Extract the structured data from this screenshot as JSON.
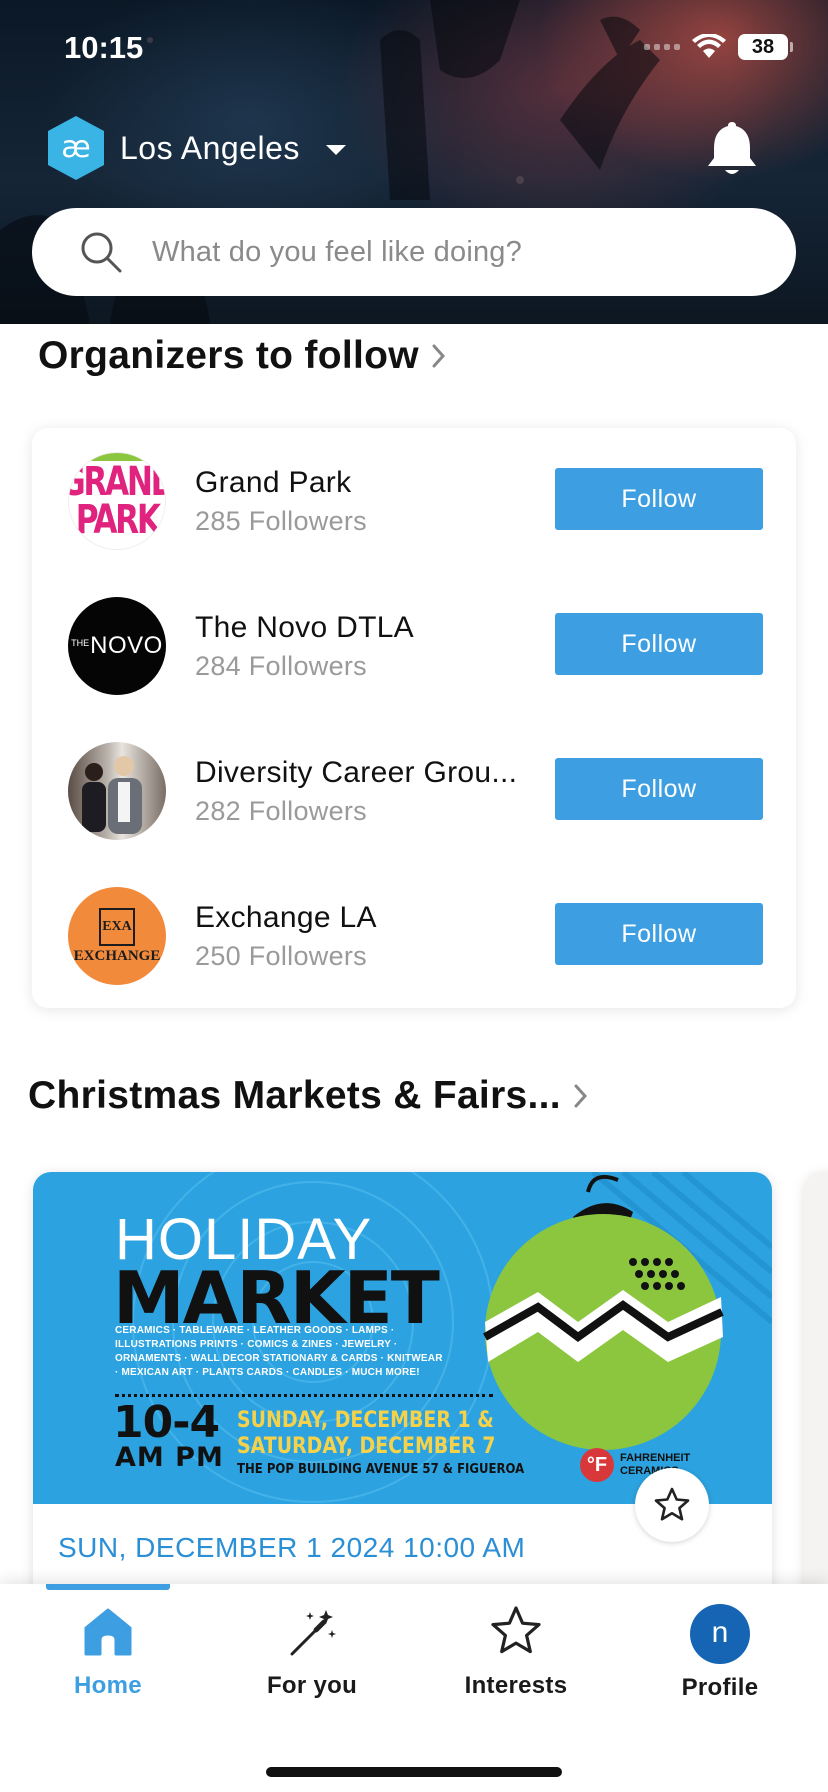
{
  "status_bar": {
    "time": "10:15",
    "battery": "38"
  },
  "header": {
    "location": "Los Angeles",
    "search_placeholder": "What do you feel like doing?",
    "colors": {
      "logo": "#3ab3e5"
    }
  },
  "organizers": {
    "title": "Organizers to follow",
    "items": [
      {
        "name": "Grand Park",
        "followers": "285 Followers",
        "button": "Follow",
        "avatar_text": [
          "GRAND",
          "PARK"
        ]
      },
      {
        "name": "The Novo DTLA",
        "followers": "284 Followers",
        "button": "Follow",
        "avatar_text": [
          "THE",
          "NOVO"
        ]
      },
      {
        "name": "Diversity Career Grou...",
        "followers": "282 Followers",
        "button": "Follow"
      },
      {
        "name": "Exchange LA",
        "followers": "250 Followers",
        "button": "Follow",
        "avatar_text": [
          "EXA",
          "EXCHANGE"
        ]
      }
    ],
    "colors": {
      "follow_button": "#3d9ee1"
    }
  },
  "markets": {
    "title": "Christmas Markets & Fairs...",
    "event": {
      "date": "SUN, DECEMBER 1 2024 10:00 AM",
      "poster": {
        "line1": "HOLIDAY",
        "line2": "MARKET",
        "items": "CERAMICS · TABLEWARE · LEATHER GOODS · LAMPS · ILLUSTRATIONS PRINTS · COMICS & ZINES · JEWELRY · ORNAMENTS · WALL DECOR STATIONARY & CARDS · KNITWEAR · MEXICAN ART · PLANTS CARDS · CANDLES · MUCH MORE!",
        "time": "10-4",
        "ampm": "AM  PM",
        "dates_1": "SUNDAY, DECEMBER 1 &",
        "dates_2": "SATURDAY, DECEMBER 7",
        "venue": "THE POP BUILDING AVENUE 57 & FIGUEROA",
        "brand_mark": "°F",
        "brand": "FAHRENHEIT CERAMICS"
      }
    }
  },
  "bottom_nav": {
    "items": [
      {
        "label": "Home",
        "icon": "home-icon",
        "active": true
      },
      {
        "label": "For you",
        "icon": "magic-wand-icon"
      },
      {
        "label": "Interests",
        "icon": "star-icon"
      },
      {
        "label": "Profile",
        "icon": "profile-avatar",
        "initial": "n"
      }
    ],
    "colors": {
      "active": "#3d9ee1",
      "avatar": "#1565b4"
    }
  }
}
